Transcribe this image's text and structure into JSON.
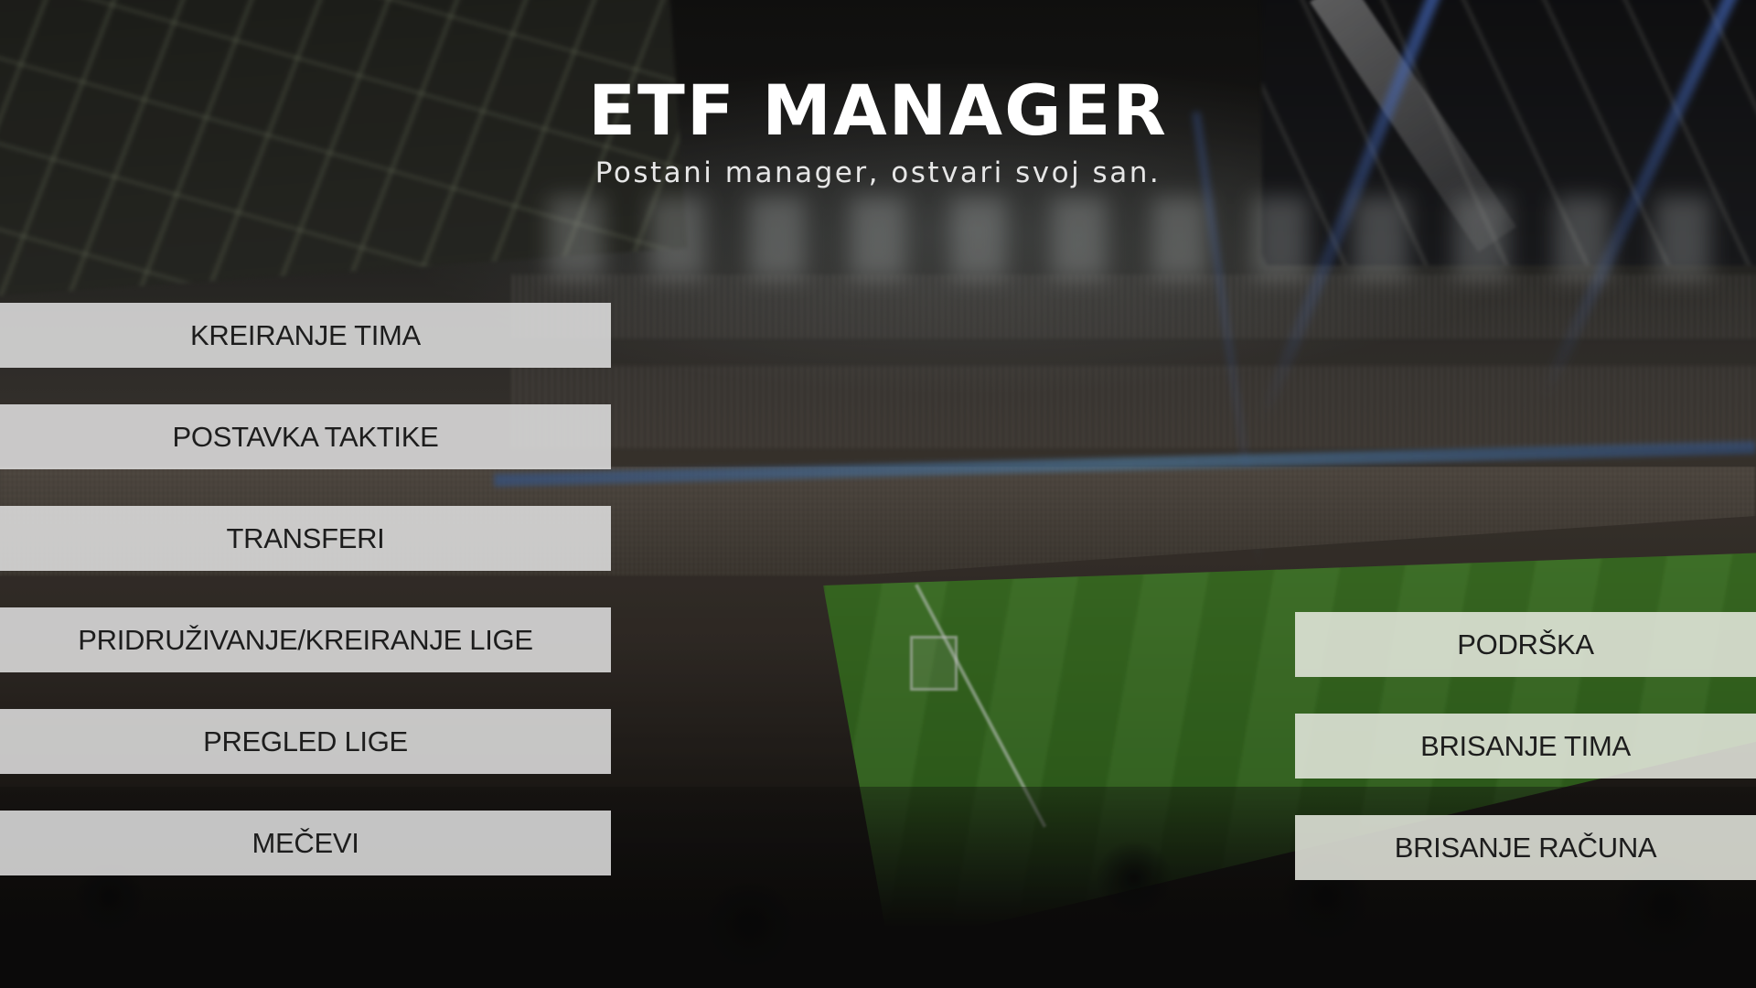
{
  "app": {
    "title": "ETF MANAGER",
    "subtitle": "Postani manager, ostvari svoj san."
  },
  "menu_left": {
    "items": [
      {
        "label": "KREIRANJE TIMA"
      },
      {
        "label": "POSTAVKA TAKTIKE"
      },
      {
        "label": "TRANSFERI"
      },
      {
        "label": "PRIDRUŽIVANJE/KREIRANJE LIGE"
      },
      {
        "label": "PREGLED LIGE"
      },
      {
        "label": "MEČEVI"
      }
    ]
  },
  "menu_right": {
    "items": [
      {
        "label": "PODRŠKA"
      },
      {
        "label": "BRISANJE TIMA"
      },
      {
        "label": "BRISANJE RAČUNA"
      }
    ]
  },
  "colors": {
    "button_background": "#e2e2e2",
    "button_text": "#1d1d1d",
    "title_text": "#ffffff",
    "pitch_green": "#3d7a24"
  },
  "background": {
    "image_description_icon": "stadium-photo-background"
  }
}
